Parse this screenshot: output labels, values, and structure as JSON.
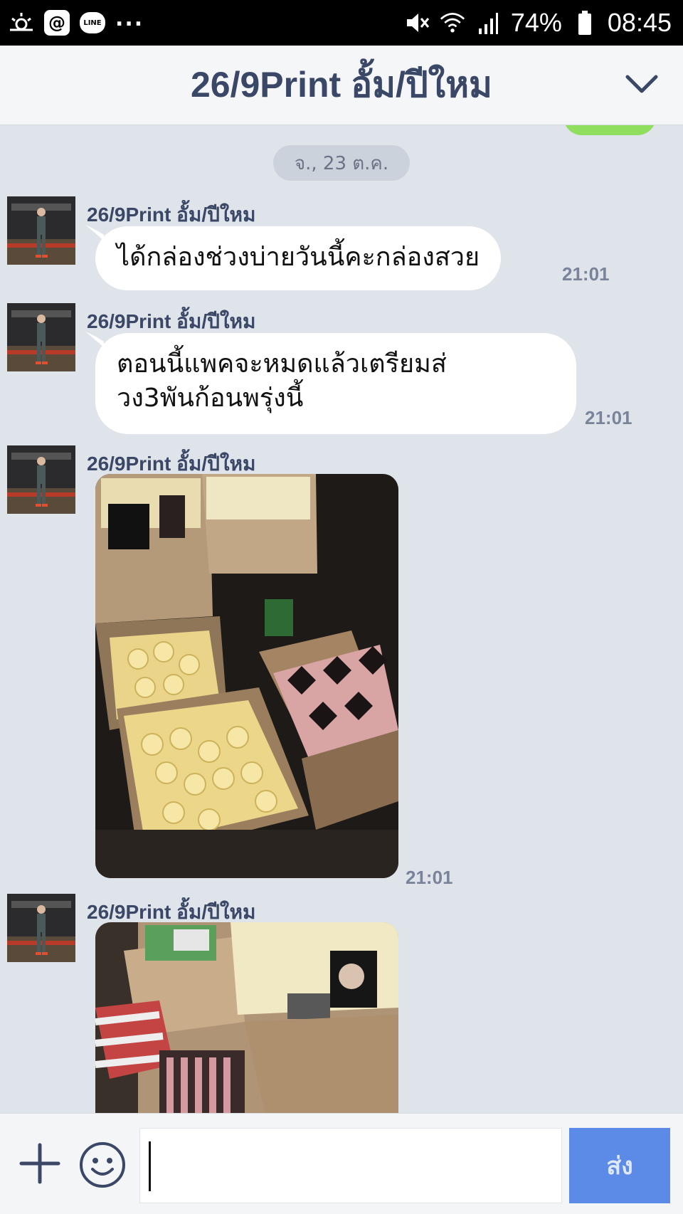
{
  "status_bar": {
    "battery": "74%",
    "time": "08:45",
    "notification_icons": [
      "brightness-icon",
      "at-icon",
      "line-icon"
    ],
    "overflow": "..."
  },
  "header": {
    "title": "26/9Print อั้ม/ปีใหม"
  },
  "chat": {
    "date_divider": "จ., 23 ต.ค.",
    "messages": [
      {
        "sender": "26/9Print อั้ม/ปีใหม",
        "type": "text",
        "text": "ได้กล่องช่วงบ่ายวันนี้คะกล่องสวย",
        "time": "21:01"
      },
      {
        "sender": "26/9Print อั้ม/ปีใหม",
        "type": "text",
        "lines": [
          "ตอนนี้แพคจะหมดแล้วเตรียมส่",
          "วง3พันก้อนพรุ่งนี้"
        ],
        "time": "21:01"
      },
      {
        "sender": "26/9Print อั้ม/ปีใหม",
        "type": "image",
        "time": "21:01"
      },
      {
        "sender": "26/9Print อั้ม/ปีใหม",
        "type": "image"
      }
    ]
  },
  "input_bar": {
    "text_value": "",
    "send_label": "ส่ง"
  },
  "colors": {
    "chat_background": "#dfe3ea",
    "header_title": "#3a4766",
    "send_button": "#5b8be6",
    "own_bubble": "#8fde5d"
  }
}
